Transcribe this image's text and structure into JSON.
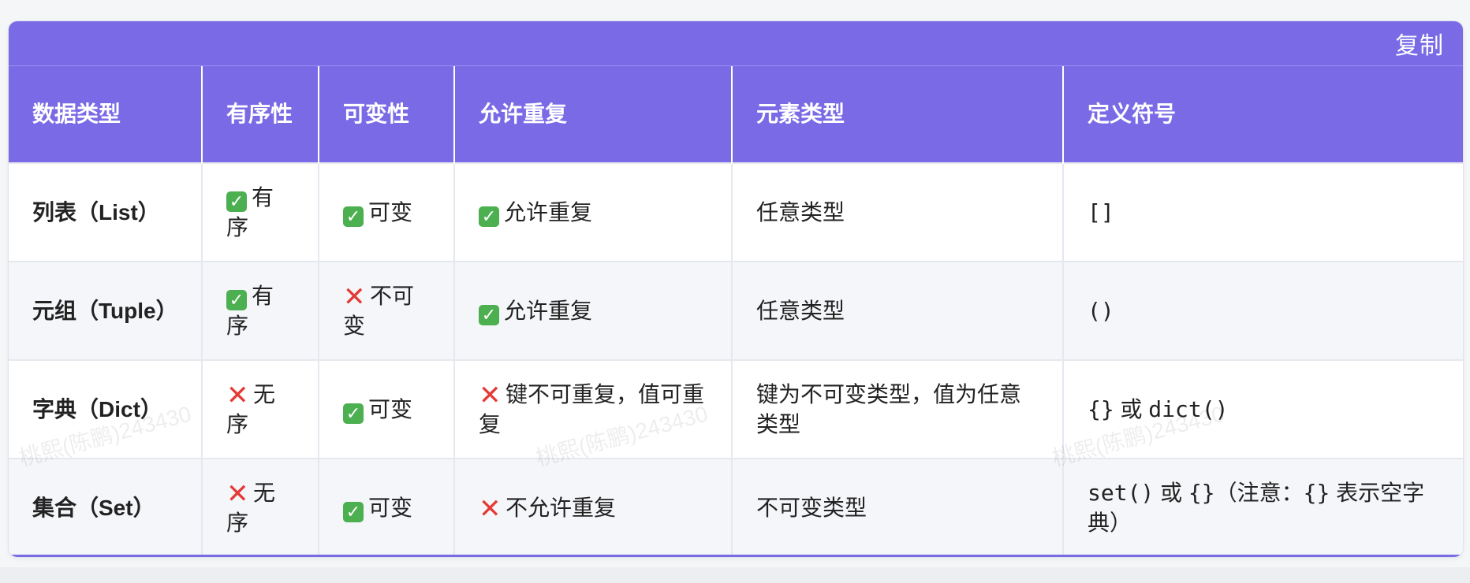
{
  "toolbar": {
    "copy_label": "复制"
  },
  "table": {
    "headers": [
      "数据类型",
      "有序性",
      "可变性",
      "允许重复",
      "元素类型",
      "定义符号"
    ],
    "rows": [
      {
        "type": "列表（List）",
        "ordered": {
          "mark": "check",
          "text": "有序"
        },
        "mutable": {
          "mark": "check",
          "text": "可变"
        },
        "duplicates": {
          "mark": "check",
          "text": "允许重复"
        },
        "element_type": "任意类型",
        "symbol": "[]"
      },
      {
        "type": "元组（Tuple）",
        "ordered": {
          "mark": "check",
          "text": "有序"
        },
        "mutable": {
          "mark": "cross",
          "text": "不可变"
        },
        "duplicates": {
          "mark": "check",
          "text": "允许重复"
        },
        "element_type": "任意类型",
        "symbol": "()"
      },
      {
        "type": "字典（Dict）",
        "ordered": {
          "mark": "cross",
          "text": "无序"
        },
        "mutable": {
          "mark": "check",
          "text": "可变"
        },
        "duplicates": {
          "mark": "cross",
          "text": "键不可重复，值可重复"
        },
        "element_type": "键为不可变类型，值为任意类型",
        "symbol_code1": "{}",
        "symbol_or": " 或 ",
        "symbol_code2": "dict()"
      },
      {
        "type": "集合（Set）",
        "ordered": {
          "mark": "cross",
          "text": "无序"
        },
        "mutable": {
          "mark": "check",
          "text": "可变"
        },
        "duplicates": {
          "mark": "cross",
          "text": "不允许重复"
        },
        "element_type": "不可变类型",
        "symbol_code1": "set()",
        "symbol_or": " 或 ",
        "symbol_code2": "{}",
        "symbol_note_a": "（注意：",
        "symbol_code3": "{}",
        "symbol_note_b": " 表示空字典）"
      }
    ]
  },
  "watermarks": [
    "桃熙(陈鹏)243430",
    "桃熙(陈鹏)243430",
    "桃熙(陈鹏)243430"
  ],
  "colors": {
    "header_bg": "#7a6ae6",
    "check_green": "#4caf50",
    "cross_red": "#e53935"
  },
  "icons": {
    "check": "check-mark-icon",
    "cross": "cross-mark-icon"
  }
}
